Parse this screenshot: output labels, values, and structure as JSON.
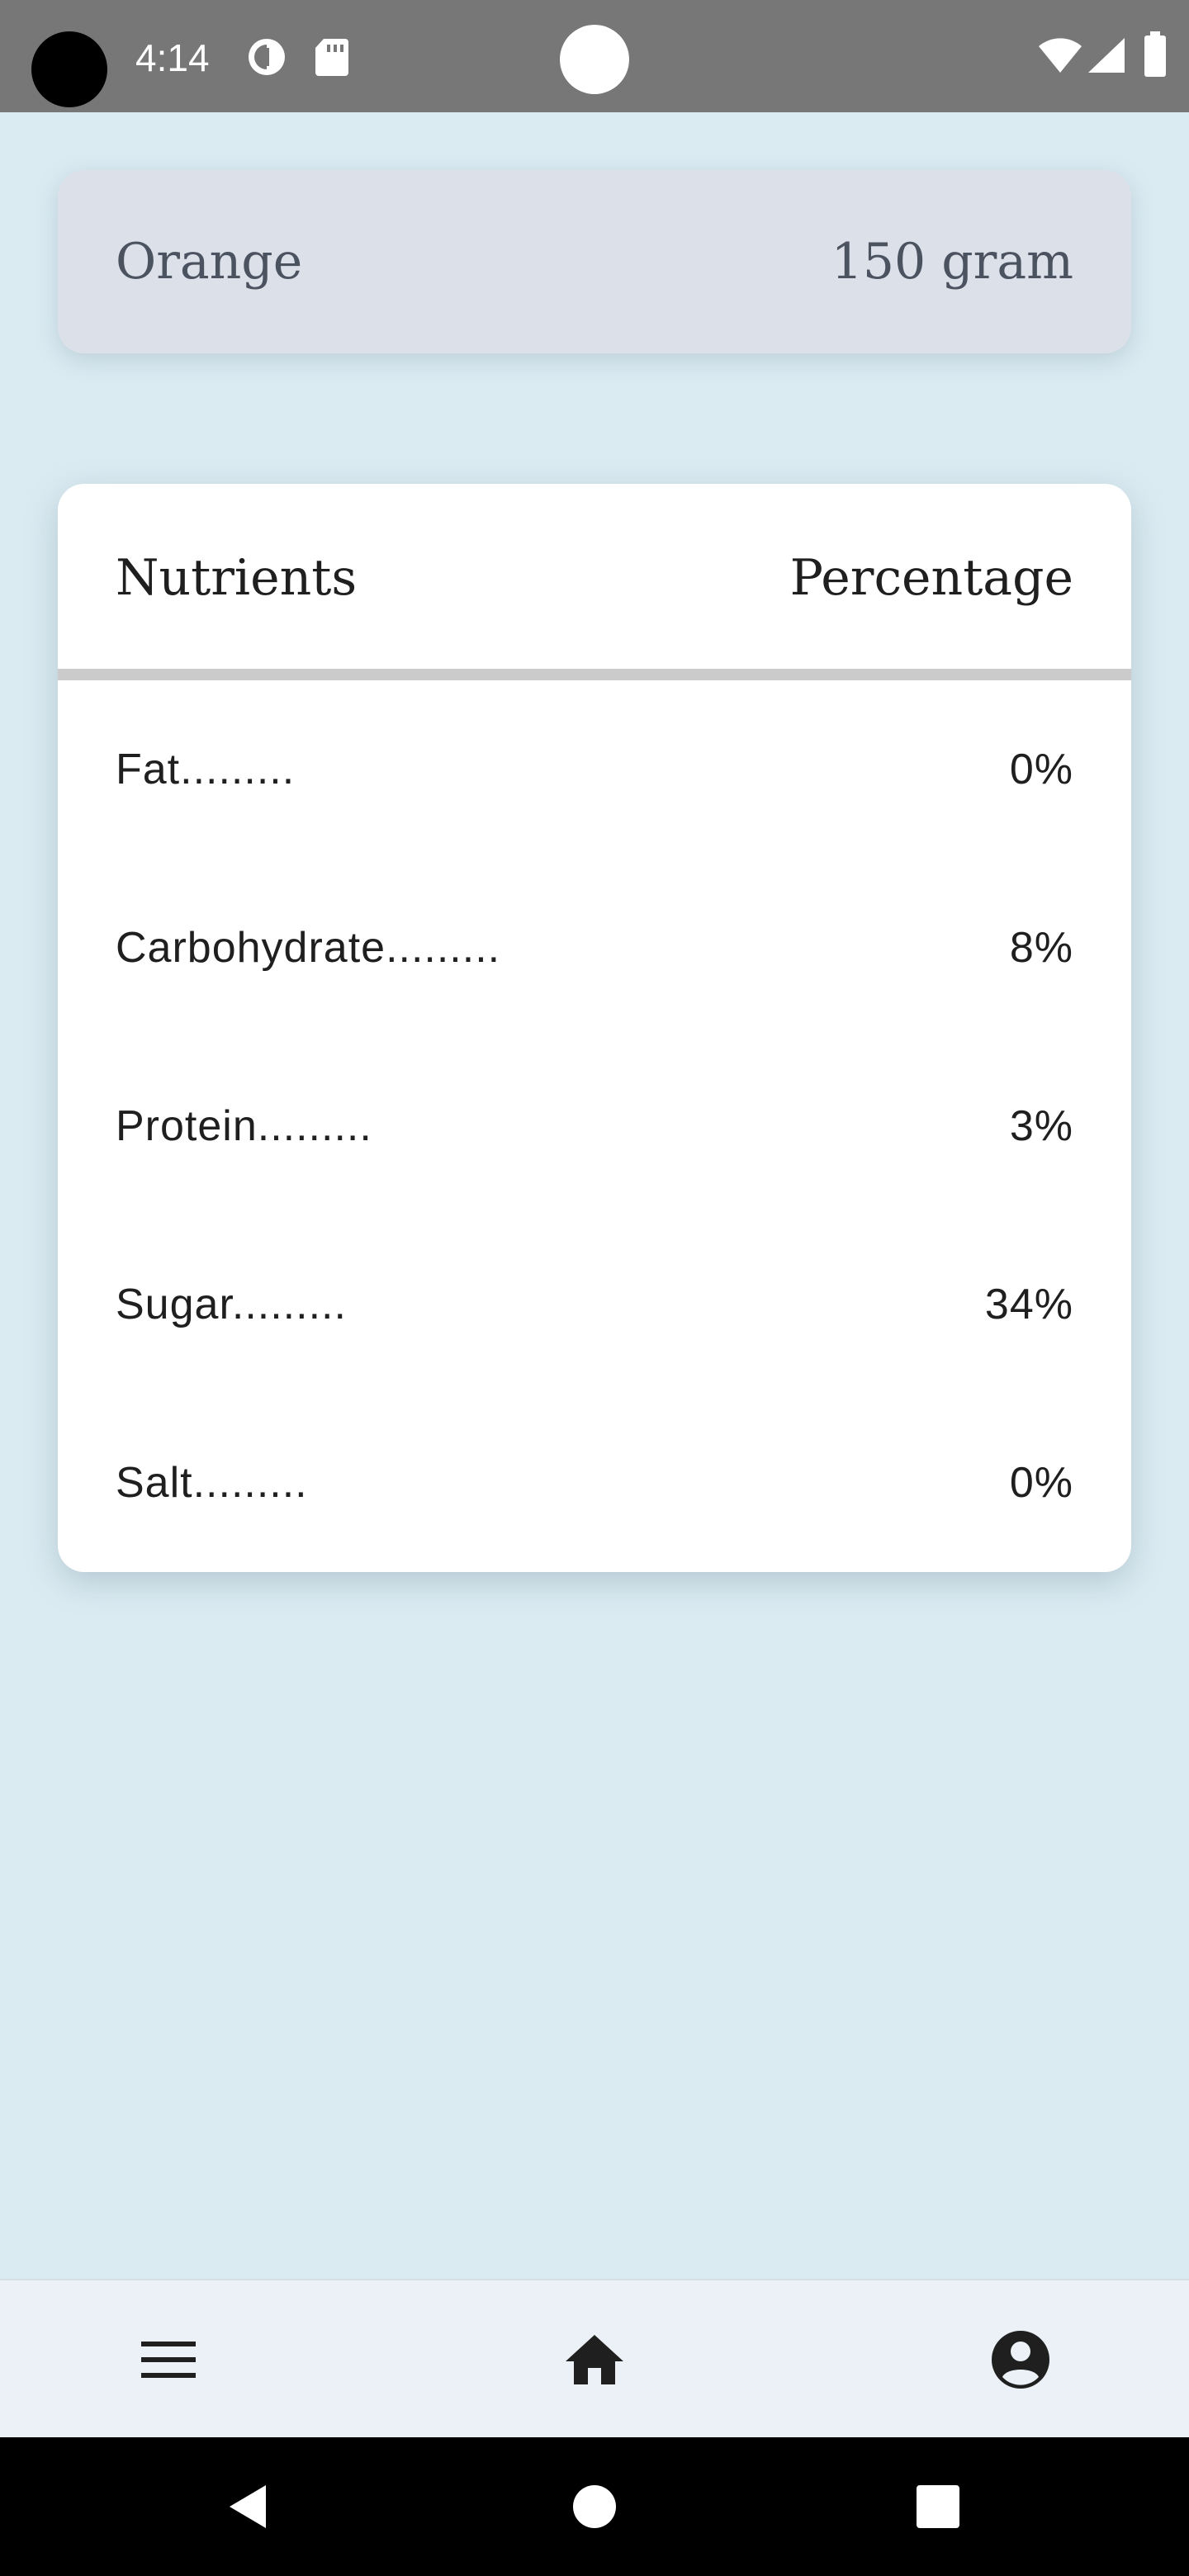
{
  "status_bar": {
    "time": "4:14",
    "icons": [
      "camera-cutout",
      "data-saver-icon",
      "sd-card-icon",
      "wifi-icon",
      "signal-icon",
      "battery-icon"
    ]
  },
  "product": {
    "name": "Orange",
    "amount": "150 gram"
  },
  "table": {
    "header": {
      "nutrients_label": "Nutrients",
      "percentage_label": "Percentage"
    },
    "rows": [
      {
        "name": "Fat.........",
        "value": "0%"
      },
      {
        "name": "Carbohydrate.........",
        "value": "8%"
      },
      {
        "name": "Protein.........",
        "value": "3%"
      },
      {
        "name": "Sugar.........",
        "value": "34%"
      },
      {
        "name": "Salt.........",
        "value": "0%"
      }
    ]
  },
  "bottom_nav": {
    "items": [
      "menu-icon",
      "home-icon",
      "account-icon"
    ]
  },
  "system_nav": {
    "items": [
      "back-icon",
      "home-circle-icon",
      "recents-icon"
    ]
  },
  "colors": {
    "background": "#dbebf2",
    "status_bar": "#777777",
    "product_card": "#dce1e9",
    "card": "#ffffff",
    "divider": "#cbcbcb",
    "bottom_nav": "#ebf1f7",
    "system_nav": "#000000"
  }
}
